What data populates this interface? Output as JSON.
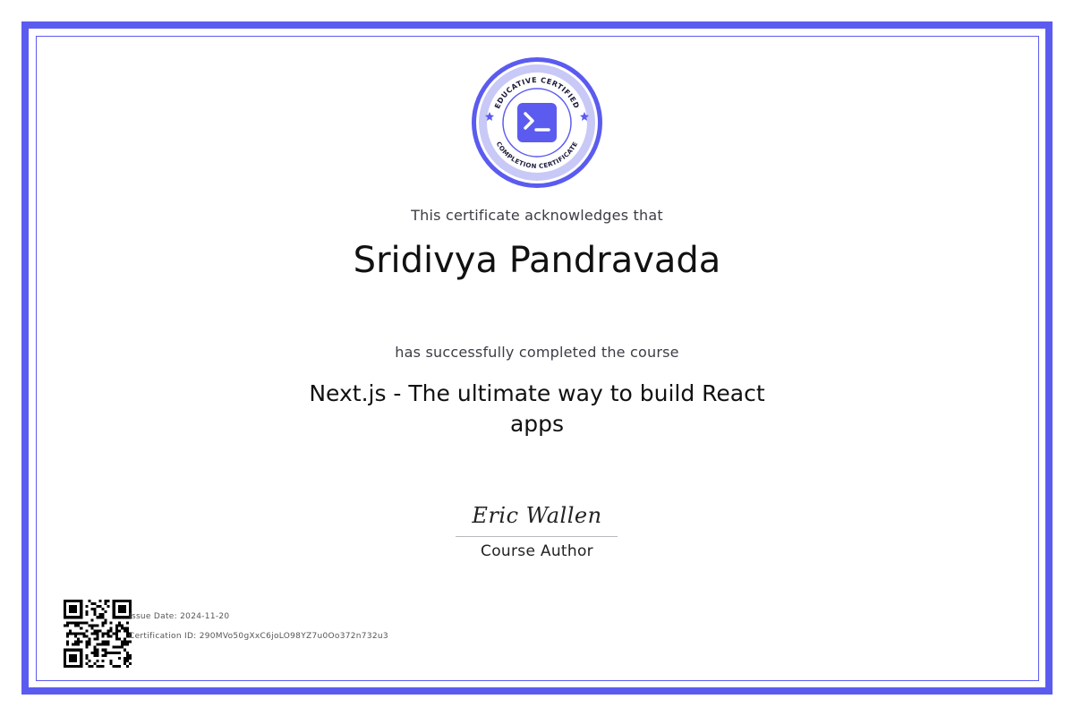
{
  "certificate": {
    "badge": {
      "top_text": "EDUCATIVE CERTIFIED",
      "bottom_text": "COMPLETION CERTIFICATE",
      "icon": "terminal-icon"
    },
    "acknowledges_text": "This certificate acknowledges that",
    "recipient_name": "Sridivya Pandravada",
    "completed_text": "has successfully completed the course",
    "course_title": "Next.js - The ultimate way to build React apps",
    "signature_name": "Eric Wallen",
    "signature_role": "Course Author",
    "issue_date_label": "Issue Date:",
    "issue_date": "2024-11-20",
    "certification_id_label": "Certification ID:",
    "certification_id": "290MVo50gXxC6joLO98YZ7u0Oo372n732u3"
  },
  "colors": {
    "accent": "#5b5bf0",
    "badge_ring_light": "#c9c9f7",
    "text_dark": "#111111",
    "text_muted": "#3c3c46"
  }
}
